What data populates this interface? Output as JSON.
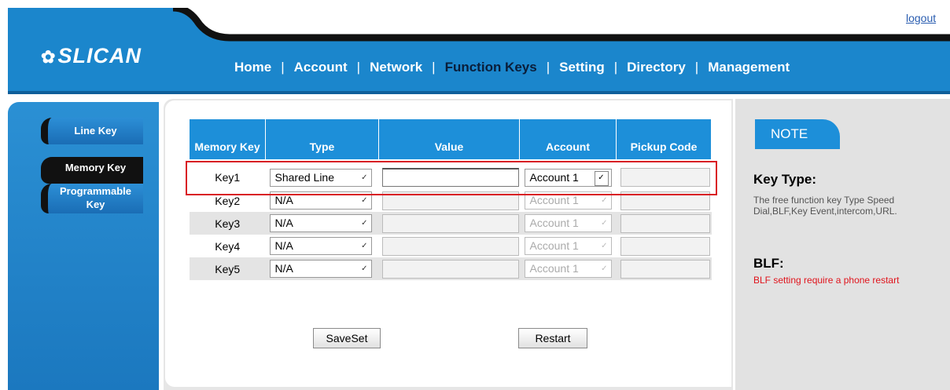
{
  "header": {
    "logout": "logout",
    "logo": "SLICAN",
    "nav": [
      "Home",
      "Account",
      "Network",
      "Function Keys",
      "Setting",
      "Directory",
      "Management"
    ],
    "active_nav": "Function Keys",
    "colors": {
      "banner": "#1b86cc",
      "active_text": "#0a1e3a"
    }
  },
  "sidebar": {
    "items": [
      {
        "label": "Line Key"
      },
      {
        "label": "Memory Key"
      },
      {
        "label_line1": "Programmable",
        "label_line2": "Key"
      }
    ],
    "active": "Memory Key"
  },
  "table": {
    "headers": [
      "Memory Key",
      "Type",
      "Value",
      "Account",
      "Pickup Code"
    ],
    "rows": [
      {
        "key": "Key1",
        "type": "Shared Line",
        "value": "",
        "account": "Account 1",
        "pickup": ""
      },
      {
        "key": "Key2",
        "type": "N/A",
        "value": "",
        "account": "Account 1",
        "pickup": ""
      },
      {
        "key": "Key3",
        "type": "N/A",
        "value": "",
        "account": "Account 1",
        "pickup": ""
      },
      {
        "key": "Key4",
        "type": "N/A",
        "value": "",
        "account": "Account 1",
        "pickup": ""
      },
      {
        "key": "Key5",
        "type": "N/A",
        "value": "",
        "account": "Account 1",
        "pickup": ""
      }
    ]
  },
  "buttons": {
    "save": "SaveSet",
    "restart": "Restart"
  },
  "note": {
    "tab": "NOTE",
    "h1": "Key Type:",
    "p1": "The free function key Type Speed Dial,BLF,Key Event,intercom,URL.",
    "h2": "BLF:",
    "p2": "BLF setting require a phone restart",
    "colors": {
      "warning": "#e0141c",
      "highlight_border": "#d91b24"
    }
  }
}
